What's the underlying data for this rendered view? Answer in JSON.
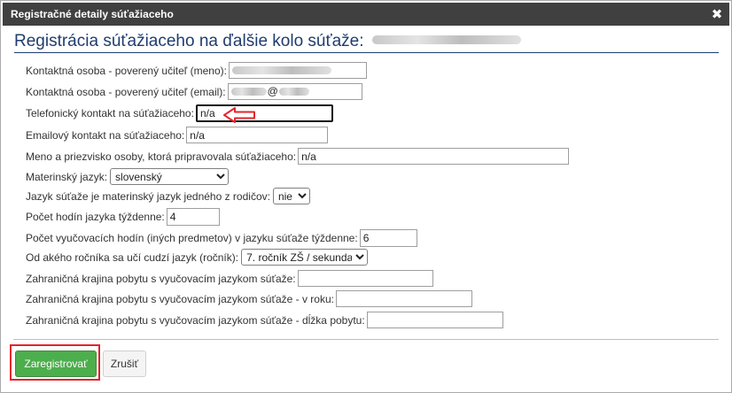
{
  "dialog": {
    "title": "Registračné detaily súťažiaceho",
    "close_glyph": "✖",
    "heading": "Registrácia súťažiaceho na ďalšie kolo súťaže:"
  },
  "form": {
    "teacher_name_label": "Kontaktná osoba - poverený učiteľ (meno):",
    "teacher_email_label": "Kontaktná osoba - poverený učiteľ (email):",
    "teacher_email_value_suffix": "@",
    "phone_label": "Telefonický kontakt na súťažiaceho:",
    "phone_value": "n/a",
    "email_label": "Emailový kontakt na súťažiaceho:",
    "email_value": "n/a",
    "preparer_label": "Meno a priezvisko osoby, ktorá pripravovala súťažiaceho:",
    "preparer_value": "n/a",
    "mother_tongue_label": "Materinský jazyk:",
    "mother_tongue_value": "slovenský",
    "parent_language_label": "Jazyk súťaže je materinský jazyk jedného z rodičov:",
    "parent_language_value": "nie",
    "hours_language_label": "Počet hodín jazyka týždenne:",
    "hours_language_value": "4",
    "hours_other_label": "Počet vyučovacích hodín (iných predmetov) v jazyku súťaže týždenne:",
    "hours_other_value": "6",
    "start_grade_label": "Od akého ročníka sa učí cudzí jazyk (ročník):",
    "start_grade_value": "7. ročník ZŠ / sekunda",
    "abroad_country_label": "Zahraničná krajina pobytu s vyučovacím jazykom súťaže:",
    "abroad_country_value": "",
    "abroad_year_label": "Zahraničná krajina pobytu s vyučovacím jazykom súťaže - v roku:",
    "abroad_year_value": "",
    "abroad_length_label": "Zahraničná krajina pobytu s vyučovacím jazykom súťaže - dĺžka pobytu:",
    "abroad_length_value": ""
  },
  "buttons": {
    "register_label": "Zaregistrovať",
    "cancel_label": "Zrušiť"
  },
  "colors": {
    "titlebar": "#404040",
    "heading": "#1f3d6e",
    "primary_button": "#4cae4c",
    "highlight": "#e3242b"
  },
  "icons": {
    "close": "close-icon",
    "arrow": "arrow-left-icon"
  }
}
